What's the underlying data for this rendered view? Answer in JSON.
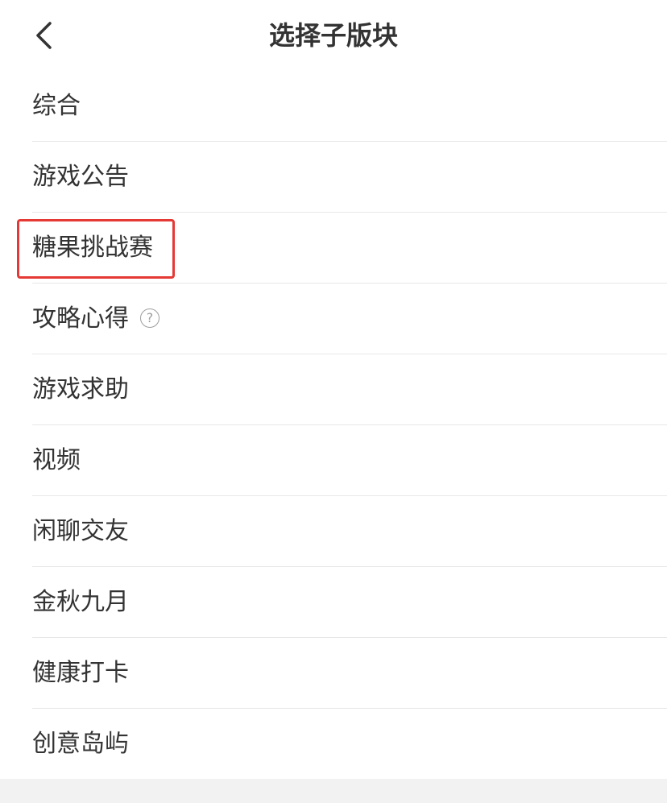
{
  "header": {
    "title": "选择子版块",
    "back_icon": "chevron-left-icon"
  },
  "items": [
    {
      "label": "综合"
    },
    {
      "label": "游戏公告"
    },
    {
      "label": "糖果挑战赛",
      "highlighted": true,
      "highlight_color": "#e53935"
    },
    {
      "label": "攻略心得",
      "help_icon": "?"
    },
    {
      "label": "游戏求助"
    },
    {
      "label": "视频"
    },
    {
      "label": "闲聊交友"
    },
    {
      "label": "金秋九月"
    },
    {
      "label": "健康打卡"
    },
    {
      "label": "创意岛屿"
    }
  ],
  "colors": {
    "text": "#333333",
    "divider": "#e8e8e8",
    "highlight_border": "#e53935",
    "footer_bg": "#f2f2f2"
  }
}
